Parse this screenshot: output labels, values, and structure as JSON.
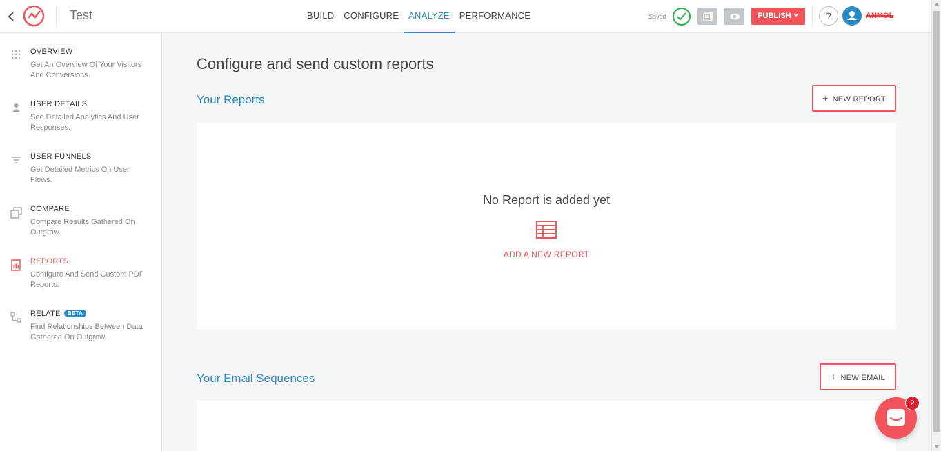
{
  "header": {
    "app_title": "Test",
    "tabs": [
      {
        "label": "BUILD"
      },
      {
        "label": "CONFIGURE"
      },
      {
        "label": "ANALYZE"
      },
      {
        "label": "PERFORMANCE"
      }
    ],
    "active_tab": "ANALYZE",
    "saved_label": "Saved",
    "publish_label": "PUBLISH",
    "help_label": "?",
    "username": "ANMOL"
  },
  "sidebar": {
    "items": [
      {
        "label": "OVERVIEW",
        "desc": "Get An Overview Of Your Visitors And Conversions.",
        "icon": "grid-dots-icon"
      },
      {
        "label": "USER DETAILS",
        "desc": "See Detailed Analytics And User Responses.",
        "icon": "user-icon"
      },
      {
        "label": "USER FUNNELS",
        "desc": "Get Detailed Metrics On User Flows.",
        "icon": "funnel-icon"
      },
      {
        "label": "COMPARE",
        "desc": "Compare Results Gathered On Outgrow.",
        "icon": "compare-icon"
      },
      {
        "label": "REPORTS",
        "desc": "Configure And Send Custom PDF Reports.",
        "icon": "report-icon",
        "active": true
      },
      {
        "label": "RELATE",
        "badge": "BETA",
        "desc": "Find Relationships Between Data Gathered On Outgrow.",
        "icon": "relate-icon"
      }
    ]
  },
  "main": {
    "page_title": "Configure and send custom reports",
    "reports": {
      "title": "Your Reports",
      "new_button": "NEW REPORT",
      "empty_text": "No Report is added yet",
      "add_link": "ADD A NEW REPORT"
    },
    "emails": {
      "title": "Your Email Sequences",
      "new_button": "NEW EMAIL"
    }
  },
  "chat": {
    "badge_count": "2"
  },
  "colors": {
    "accent": "#f2545b",
    "link_blue": "#2b8ac4",
    "success": "#28b14a"
  }
}
